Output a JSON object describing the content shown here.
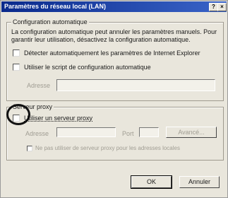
{
  "title": "Paramètres du réseau local (LAN)",
  "title_buttons": {
    "help": "?",
    "close": "×"
  },
  "auto_config": {
    "legend": "Configuration automatique",
    "description": "La configuration automatique peut annuler les paramètres manuels. Pour garantir leur utilisation, désactivez la configuration automatique.",
    "detect_label": "Détecter automatiquement les paramètres de Internet Explorer",
    "script_label": "Utiliser le script de configuration automatique",
    "address_label": "Adresse",
    "address_value": ""
  },
  "proxy": {
    "legend": "Serveur proxy",
    "use_proxy_label": "Utiliser un serveur proxy",
    "address_label": "Adresse",
    "address_value": "",
    "port_label": "Port",
    "port_value": "",
    "advanced_button": "Avancé...",
    "bypass_label": "Ne pas utiliser de serveur proxy pour les adresses locales"
  },
  "buttons": {
    "ok": "OK",
    "cancel": "Annuler"
  }
}
